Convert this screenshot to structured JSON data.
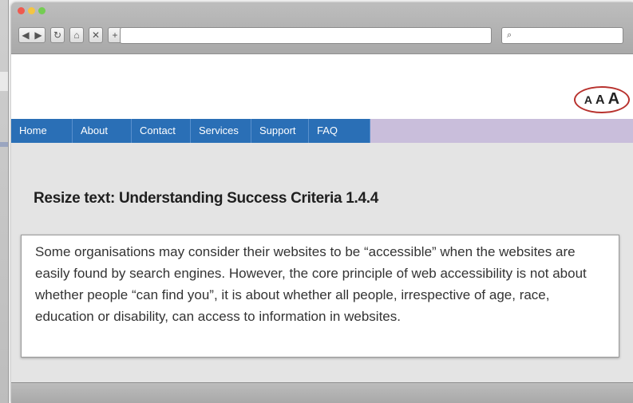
{
  "browser": {
    "search_icon": "magnifier-icon",
    "new_tab_label": "+"
  },
  "header": {
    "text_size_controls": [
      "A",
      "A",
      "A"
    ]
  },
  "nav": {
    "items": [
      {
        "label": "Home"
      },
      {
        "label": "About"
      },
      {
        "label": "Contact"
      },
      {
        "label": "Services"
      },
      {
        "label": "Support"
      },
      {
        "label": "FAQ"
      }
    ]
  },
  "main": {
    "heading": "Resize text: Understanding Success Criteria 1.4.4",
    "body": "Some organisations may consider their websites to be “accessible” when the websites are easily found by search engines. However, the core principle of web accessibility is not about whether people “can find you”, it is about whether all people, irrespective of age, race, education or disability, can access to information in websites."
  },
  "colors": {
    "nav_bg": "#2a6fb6",
    "nav_strip": "#c9bedb",
    "text_size_ring": "#b8322e"
  }
}
